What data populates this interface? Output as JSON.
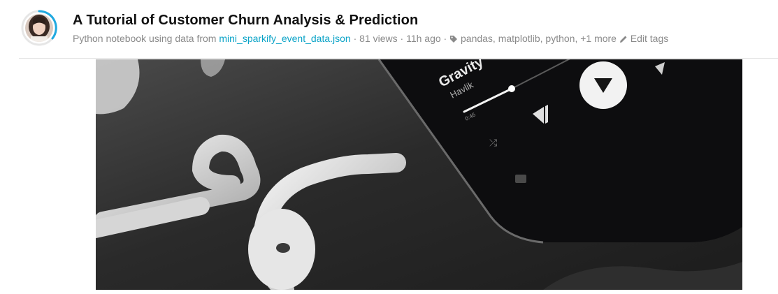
{
  "notebook": {
    "title": "A Tutorial of Customer Churn Analysis & Prediction",
    "type_prefix": "Python notebook using data from",
    "dataset_link": "mini_sparkify_event_data.json",
    "views": "81 views",
    "age": "11h ago",
    "tags": "pandas, matplotlib, python, +1 more",
    "edit_tags": "Edit tags",
    "separator": " · "
  },
  "hero_image": {
    "track_title": "Gravity",
    "artist": "Havlik",
    "elapsed": "0:46"
  },
  "icons": {
    "tag": "tag-icon",
    "edit": "pencil-icon",
    "avatar": "user-avatar"
  },
  "colors": {
    "link": "#0aa3c7",
    "avatar_ring": "#1fa9e0",
    "meta_text": "#8a8a8a",
    "title_text": "#111111"
  }
}
